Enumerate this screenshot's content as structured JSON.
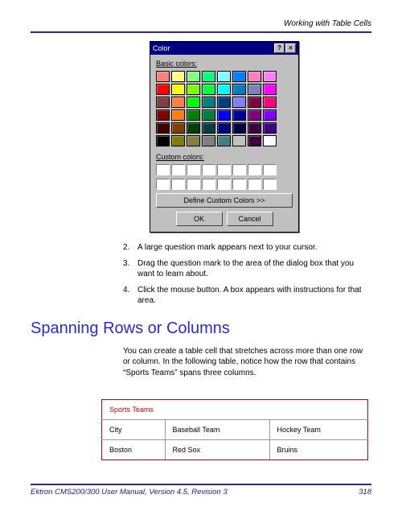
{
  "header": {
    "section": "Working with Table Cells"
  },
  "dialog": {
    "title": "Color",
    "basic_label": "Basic colors:",
    "custom_label": "Custom colors:",
    "define_btn": "Define Custom Colors >>",
    "ok": "OK",
    "cancel": "Cancel",
    "basic_colors": [
      "#ff8080",
      "#ffff80",
      "#80ff80",
      "#00ff80",
      "#80ffff",
      "#0080ff",
      "#ff80c0",
      "#ff80ff",
      "#ff0000",
      "#ffff00",
      "#80ff00",
      "#00ff40",
      "#00ffff",
      "#0080c0",
      "#8080c0",
      "#ff00ff",
      "#804040",
      "#ff8040",
      "#00ff00",
      "#008080",
      "#004080",
      "#8080ff",
      "#800040",
      "#ff0080",
      "#800000",
      "#ff8000",
      "#008000",
      "#008040",
      "#0000ff",
      "#0000a0",
      "#800080",
      "#8000ff",
      "#400000",
      "#804000",
      "#004000",
      "#004040",
      "#000080",
      "#000040",
      "#400040",
      "#400080",
      "#000000",
      "#808000",
      "#808040",
      "#808080",
      "#408080",
      "#c0c0c0",
      "#400040",
      "#ffffff"
    ]
  },
  "steps": [
    {
      "n": "2.",
      "t": "A large question mark appears next to your cursor."
    },
    {
      "n": "3.",
      "t": "Drag the question mark to the area of the dialog box that you want to learn about."
    },
    {
      "n": "4.",
      "t": "Click the mouse button. A box appears with instructions for that area."
    }
  ],
  "heading": "Spanning Rows or Columns",
  "paragraph": "You can create a table cell that stretches across more than one row or column. In the following table, notice how the row that contains “Sports Teams” spans three columns.",
  "table": {
    "span_header": "Sports Teams",
    "cols": [
      "City",
      "Baseball Team",
      "Hockey Team"
    ],
    "row": [
      "Boston",
      "Red Sox",
      "Bruins"
    ]
  },
  "footer": {
    "left": "Ektron CMS200/300 User Manual, Version 4.5, Revision 3",
    "right": "318"
  }
}
